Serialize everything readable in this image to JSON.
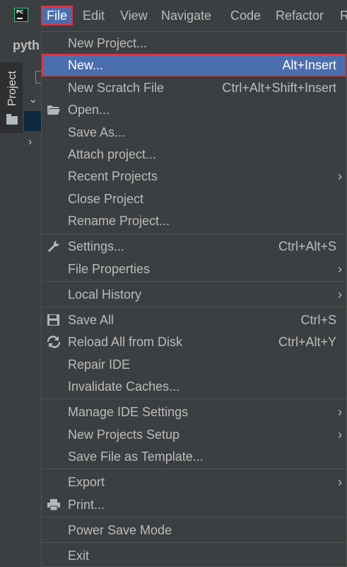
{
  "menubar": {
    "items": [
      {
        "label": "File",
        "mnemonic": "F"
      },
      {
        "label": "Edit",
        "mnemonic": "E"
      },
      {
        "label": "View",
        "mnemonic": "V"
      },
      {
        "label": "Navigate",
        "mnemonic": "N"
      },
      {
        "label": "Code",
        "mnemonic": "C"
      },
      {
        "label": "Refactor",
        "mnemonic": "R"
      },
      {
        "label": "R",
        "mnemonic": ""
      }
    ]
  },
  "toolbar": {
    "project_name": "pyth"
  },
  "side": {
    "project_tab": "Project"
  },
  "menu": {
    "items": [
      {
        "label": "New Project...",
        "shortcut": "",
        "submenu": false
      },
      {
        "label": "New...",
        "shortcut": "Alt+Insert",
        "submenu": false,
        "selected": true
      },
      {
        "label": "New Scratch File",
        "shortcut": "Ctrl+Alt+Shift+Insert",
        "submenu": false
      },
      {
        "label": "Open...",
        "shortcut": "",
        "icon": "folder-open-icon"
      },
      {
        "label": "Save As...",
        "shortcut": ""
      },
      {
        "label": "Attach project...",
        "shortcut": ""
      },
      {
        "label": "Recent Projects",
        "shortcut": "",
        "submenu": true
      },
      {
        "label": "Close Project",
        "shortcut": ""
      },
      {
        "label": "Rename Project...",
        "shortcut": ""
      },
      {
        "label": "Settings...",
        "shortcut": "Ctrl+Alt+S",
        "icon": "wrench-icon"
      },
      {
        "label": "File Properties",
        "shortcut": "",
        "submenu": true
      },
      {
        "label": "Local History",
        "shortcut": "",
        "submenu": true
      },
      {
        "label": "Save All",
        "shortcut": "Ctrl+S",
        "icon": "save-icon"
      },
      {
        "label": "Reload All from Disk",
        "shortcut": "Ctrl+Alt+Y",
        "icon": "reload-icon"
      },
      {
        "label": "Repair IDE",
        "shortcut": ""
      },
      {
        "label": "Invalidate Caches...",
        "shortcut": ""
      },
      {
        "label": "Manage IDE Settings",
        "shortcut": "",
        "submenu": true
      },
      {
        "label": "New Projects Setup",
        "shortcut": "",
        "submenu": true
      },
      {
        "label": "Save File as Template...",
        "shortcut": ""
      },
      {
        "label": "Export",
        "shortcut": "",
        "submenu": true
      },
      {
        "label": "Print...",
        "shortcut": "",
        "icon": "print-icon"
      },
      {
        "label": "Power Save Mode",
        "shortcut": ""
      },
      {
        "label": "Exit",
        "shortcut": ""
      }
    ]
  },
  "colors": {
    "background": "#3c3f41",
    "selection": "#4b6eaf",
    "highlight_border": "#e0303a",
    "text": "#bbbbbb"
  }
}
